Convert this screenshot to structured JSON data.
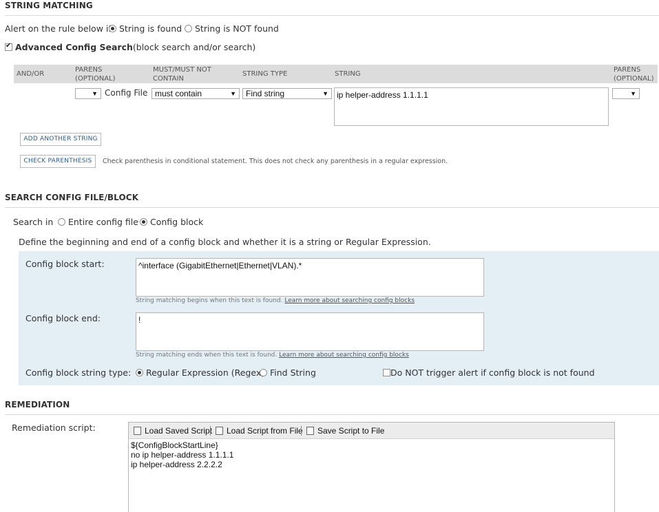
{
  "string_matching": {
    "title": "STRING MATCHING",
    "alert_label": "Alert on the rule below if",
    "option_found": "String is found",
    "option_not_found": "String is NOT found",
    "advanced_label": "Advanced Config Search",
    "advanced_suffix": "(block search and/or search)",
    "headers": {
      "and_or": "AND/OR",
      "parens1_a": "PARENS",
      "parens1_b": "(OPTIONAL)",
      "must_a": "MUST/MUST NOT",
      "must_b": "CONTAIN",
      "string_type": "STRING TYPE",
      "string": "STRING",
      "parens2_a": "PARENS",
      "parens2_b": "(OPTIONAL)"
    },
    "row": {
      "source": "Config File",
      "must_value": "must contain",
      "type_value": "Find string",
      "string_value": "ip helper-address 1.1.1.1"
    },
    "add_button": "ADD ANOTHER STRING",
    "check_button": "CHECK PARENTHESIS",
    "check_note": "Check parenthesis in conditional statement. This does not check any parenthesis in a regular expression."
  },
  "search_block": {
    "title": "SEARCH CONFIG FILE/BLOCK",
    "search_in_label": "Search in",
    "option_entire": "Entire config file",
    "option_block": "Config block",
    "description": "Define the beginning and end of a config block and whether it is a string or Regular Expression.",
    "start_label": "Config block start:",
    "start_value": "^interface (GigabitEthernet|Ethernet|VLAN).*",
    "start_hint": "String matching begins when this text is found.",
    "end_label": "Config block end:",
    "end_value": "!",
    "end_hint": "String matching ends when this text is found.",
    "learn_more": "Learn more about searching config blocks",
    "type_label": "Config block string type:",
    "option_regex": "Regular Expression (Regex)",
    "option_find": "Find String",
    "no_trigger": "Do NOT trigger alert if config block is not found"
  },
  "remediation": {
    "title": "REMEDIATION",
    "script_label": "Remediation script:",
    "load_saved": "Load Saved Script",
    "load_file": "Load Script from File",
    "save_file": "Save Script to File",
    "script_lines": [
      "${ConfigBlockStartLine}",
      "no ip helper-address 1.1.1.1",
      "ip helper-address 2.2.2.2"
    ]
  }
}
